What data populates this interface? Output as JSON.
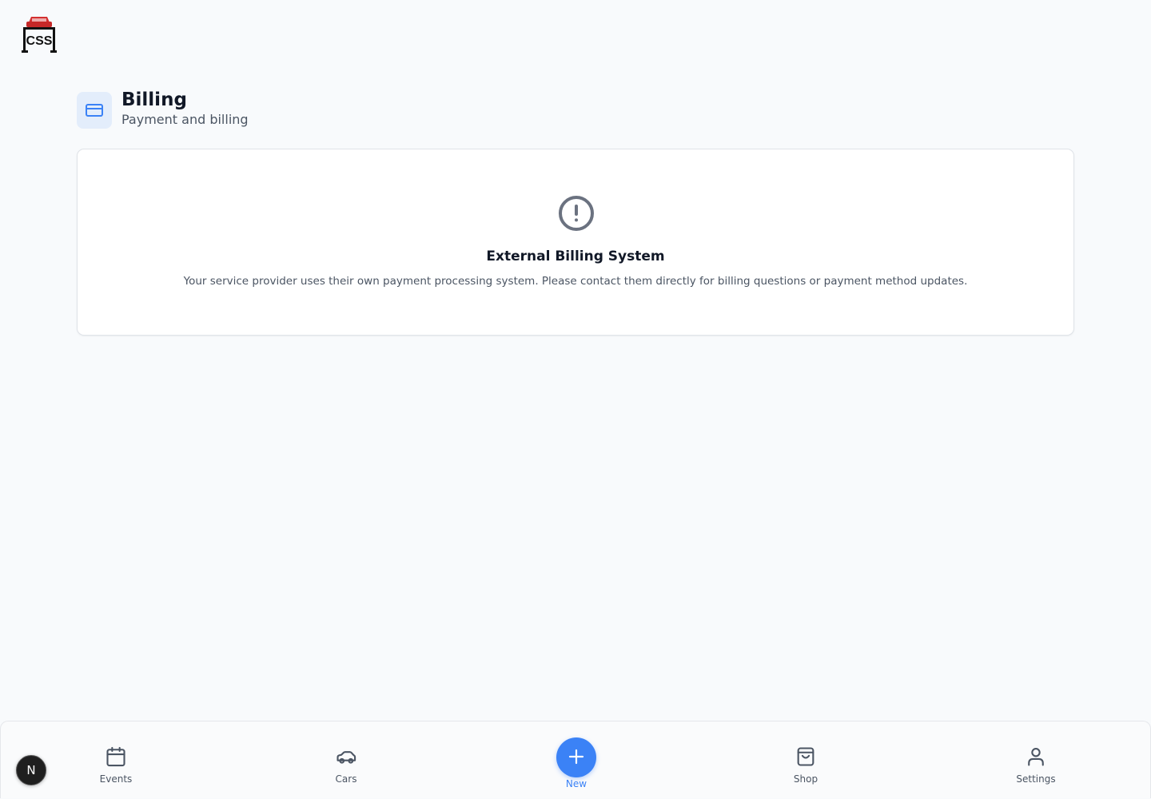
{
  "app": {
    "logo_icon": "css-logo-icon"
  },
  "section": {
    "title": "Billing",
    "subtitle": "Payment and billing",
    "icon": "credit-card-icon",
    "icon_bg": "#e3edfb",
    "icon_color": "#3b82f6"
  },
  "card": {
    "icon": "alert-circle-icon",
    "title": "External Billing System",
    "description": "Your service provider uses their own payment processing system. Please contact them directly for billing questions or payment method updates."
  },
  "user": {
    "avatar_initial": "N"
  },
  "nav": {
    "items": [
      {
        "label": "Events",
        "icon": "calendar-icon"
      },
      {
        "label": "Cars",
        "icon": "car-icon"
      },
      {
        "label": "New",
        "icon": "plus-icon"
      },
      {
        "label": "Shop",
        "icon": "shopping-bag-icon"
      },
      {
        "label": "Settings",
        "icon": "user-icon"
      }
    ],
    "accent_color": "#3b82f6"
  }
}
